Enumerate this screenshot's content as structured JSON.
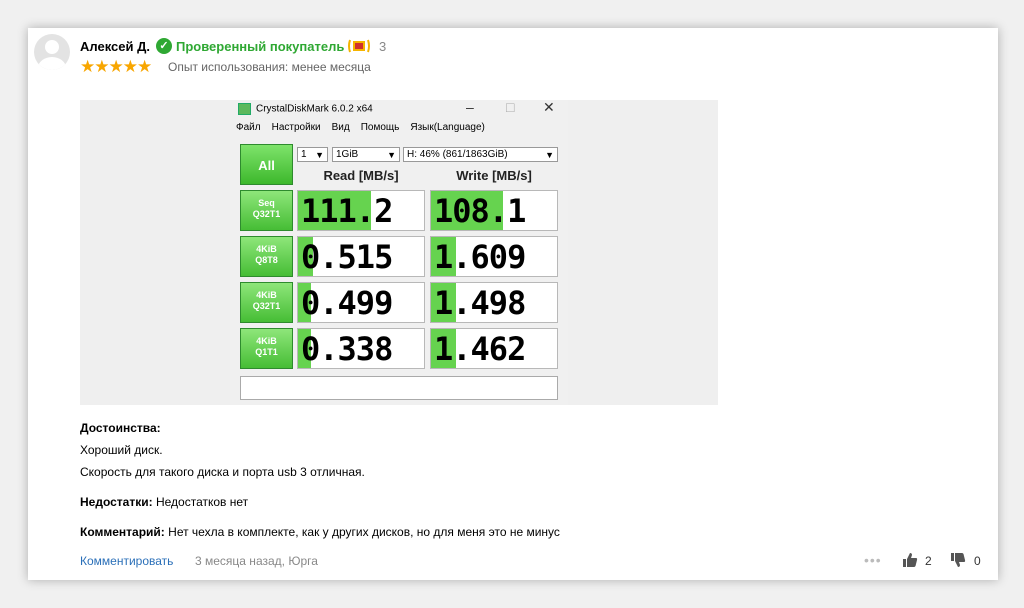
{
  "review": {
    "author": "Алексей Д.",
    "verified_label": "Проверенный покупатель",
    "medal_count": "3",
    "stars": "★★★★★",
    "experience": "Опыт использования: менее месяца",
    "rating": 5
  },
  "screenshot": {
    "window_title": "CrystalDiskMark 6.0.2 x64",
    "window_buttons": [
      "–",
      "□",
      "✕"
    ],
    "menu": [
      "Файл",
      "Настройки",
      "Вид",
      "Помощь",
      "Язык(Language)"
    ],
    "all_button": "All",
    "count_select": "1",
    "size_select": "1GiB",
    "drive_select": "H: 46% (861/1863GiB)",
    "read_header": "Read [MB/s]",
    "write_header": "Write [MB/s]",
    "rows": [
      {
        "label_top": "Seq",
        "label_bottom": "Q32T1",
        "read": "111.2",
        "write": "108.1",
        "read_fill": 0.58,
        "write_fill": 0.57
      },
      {
        "label_top": "4KiB",
        "label_bottom": "Q8T8",
        "read": "0.515",
        "write": "1.609",
        "read_fill": 0.12,
        "write_fill": 0.2
      },
      {
        "label_top": "4KiB",
        "label_bottom": "Q32T1",
        "read": "0.499",
        "write": "1.498",
        "read_fill": 0.1,
        "write_fill": 0.2
      },
      {
        "label_top": "4KiB",
        "label_bottom": "Q1T1",
        "read": "0.338",
        "write": "1.462",
        "read_fill": 0.1,
        "write_fill": 0.2
      }
    ]
  },
  "pros": {
    "title": "Достоинства:",
    "lines": [
      "Хороший диск.",
      "Скорость для такого диска и порта usb 3 отличная."
    ]
  },
  "cons": {
    "title": "Недостатки:",
    "text": "Недостатков нет"
  },
  "comment": {
    "title": "Комментарий:",
    "text": "Нет чехла в комплекте, как у других дисков, но для меня это не минус"
  },
  "footer": {
    "comment_link": "Комментировать",
    "meta": "3 месяца назад, Юрга",
    "more": "•••",
    "likes": "2",
    "dislikes": "0"
  },
  "colors": {
    "accent_green": "#2fa833",
    "link_blue": "#2a6fb8",
    "star": "#f8a600",
    "bar_green": "#66d34f"
  },
  "icons": [
    "user-avatar-icon",
    "verified-check-icon",
    "medal-icon",
    "star-icon",
    "thumb-up-icon",
    "thumb-down-icon",
    "more-icon"
  ]
}
